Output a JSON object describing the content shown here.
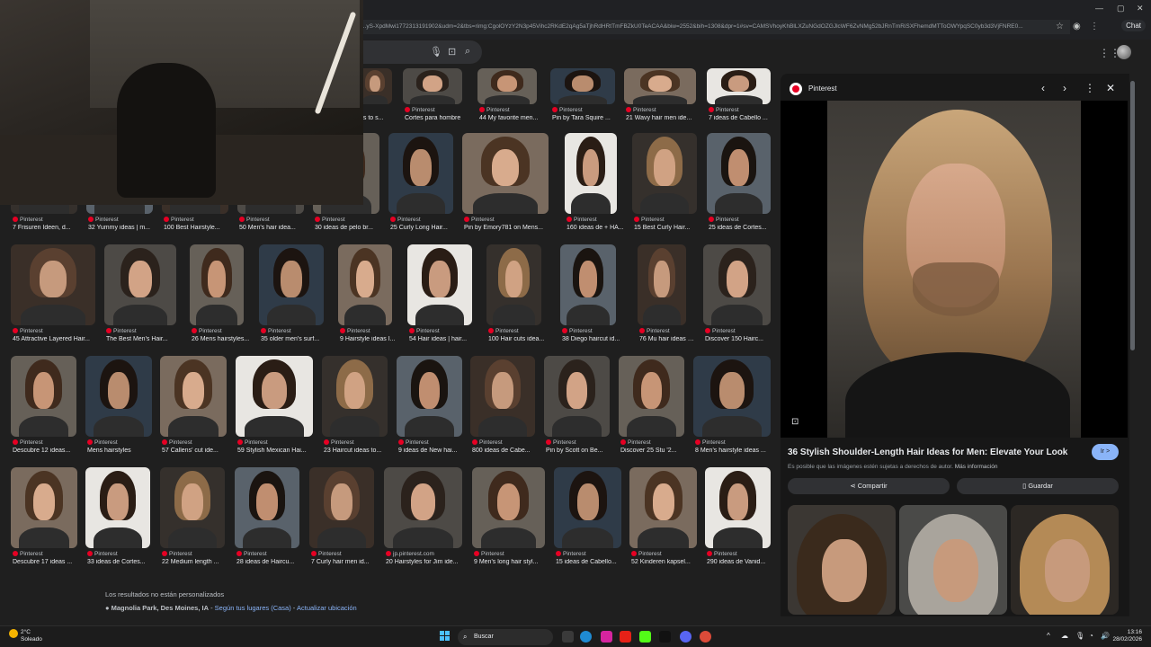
{
  "browser": {
    "url": "...yS-XpdMwi1772313191902&udm=2&tbs=rimg:CgolOYzY2N3p45Vihc2RKdE2qAg5aTjhRdHRtTmFBZkU0TeACAA&biw=2552&bih=1308&dpr=1#sv=CAMSVhoyKhBlLXZuNGdOZGJlcWF6ZvNMg52bJRnTmRiSXFhemdMTToOWYpqSC0yb3d3VjFNRE0...",
    "chat_label": "Chat",
    "window_controls": [
      "—",
      "▢",
      "✕"
    ]
  },
  "google": {
    "mic_icon": "mic-icon",
    "lens_icon": "lens-icon",
    "search_icon": "search-icon",
    "apps_icon": "apps-grid-icon"
  },
  "grid": {
    "rows": [
      {
        "items": [
          {
            "source": "",
            "title": "as to s..."
          },
          {
            "source": "Pinterest",
            "title": "Cortes para hombre"
          },
          {
            "source": "Pinterest",
            "title": "44 My favorite men..."
          },
          {
            "source": "Pinterest",
            "title": "Pin by Tara Squire ..."
          },
          {
            "source": "Pinterest",
            "title": "21 Wavy hair men ide..."
          },
          {
            "source": "Pinterest",
            "title": "7 ideas de Cabello ..."
          }
        ]
      },
      {
        "items": [
          {
            "source": "Pinterest",
            "title": "7 Frisuren Ideen, d..."
          },
          {
            "source": "Pinterest",
            "title": "32 Yummy ideas | m..."
          },
          {
            "source": "Pinterest",
            "title": "100 Best Hairstyle..."
          },
          {
            "source": "Pinterest",
            "title": "50 Men's hair idea..."
          },
          {
            "source": "Pinterest",
            "title": "30 ideas de pelo br..."
          },
          {
            "source": "Pinterest",
            "title": "25 Curly Long Hair..."
          },
          {
            "source": "Pinterest",
            "title": "Pin by Emory781 on Mens..."
          },
          {
            "source": "Pinterest",
            "title": "160 ideas de + HA..."
          },
          {
            "source": "Pinterest",
            "title": "15 Best Curly Hair..."
          },
          {
            "source": "Pinterest",
            "title": "25 ideas de Cortes..."
          }
        ]
      },
      {
        "items": [
          {
            "source": "Pinterest",
            "title": "45 Attractive Layered Hair..."
          },
          {
            "source": "Pinterest",
            "title": "The Best Men's Hair..."
          },
          {
            "source": "Pinterest",
            "title": "26 Mens hairstyles..."
          },
          {
            "source": "Pinterest",
            "title": "35 older men's surf..."
          },
          {
            "source": "Pinterest",
            "title": "9 Hairstyle ideas I..."
          },
          {
            "source": "Pinterest",
            "title": "54 Hair ideas | hair..."
          },
          {
            "source": "Pinterest",
            "title": "100 Hair cuts idea..."
          },
          {
            "source": "Pinterest",
            "title": "38 Diego haircut id..."
          },
          {
            "source": "Pinterest",
            "title": "76 Mu hair ideas | ..."
          },
          {
            "source": "Pinterest",
            "title": "Discover 150 Hairc..."
          }
        ]
      },
      {
        "items": [
          {
            "source": "Pinterest",
            "title": "Descubre 12 ideas..."
          },
          {
            "source": "Pinterest",
            "title": "Mens hairstyles"
          },
          {
            "source": "Pinterest",
            "title": "57 Callens' cut ide..."
          },
          {
            "source": "Pinterest",
            "title": "59 Stylish Mexican Hai..."
          },
          {
            "source": "Pinterest",
            "title": "23 Haircut ideas to..."
          },
          {
            "source": "Pinterest",
            "title": "9 ideas de New hai..."
          },
          {
            "source": "Pinterest",
            "title": "800 ideas de Cabe..."
          },
          {
            "source": "Pinterest",
            "title": "Pin by Scott on Be..."
          },
          {
            "source": "Pinterest",
            "title": "Discover 25 Stu '2..."
          },
          {
            "source": "Pinterest",
            "title": "8 Men's hairstyle ideas ..."
          }
        ]
      },
      {
        "items": [
          {
            "source": "Pinterest",
            "title": "Descubre 17 ideas ..."
          },
          {
            "source": "Pinterest",
            "title": "33 ideas de Cortes..."
          },
          {
            "source": "Pinterest",
            "title": "22 Medium length ..."
          },
          {
            "source": "Pinterest",
            "title": "28 ideas de Haircu..."
          },
          {
            "source": "Pinterest",
            "title": "7 Curly hair men id..."
          },
          {
            "source": "jp.pinterest.com",
            "title": "20 Hairstyles for Jim ide..."
          },
          {
            "source": "Pinterest",
            "title": "9 Men's long hair styl..."
          },
          {
            "source": "Pinterest",
            "title": "15 ideas de Cabello..."
          },
          {
            "source": "Pinterest",
            "title": "52 Kinderen kapsel..."
          },
          {
            "source": "Pinterest",
            "title": "290 ideas de Vanid..."
          }
        ]
      }
    ]
  },
  "footer": {
    "note": "Los resultados no están personalizados",
    "location_bold": "Magnolia Park, Des Moines, IA",
    "location_sep1": " - ",
    "location_link1": "Según tus lugares (Casa)",
    "location_sep2": " - ",
    "location_link2": "Actualizar ubicación"
  },
  "panel": {
    "source": "Pinterest",
    "title": "36 Stylish Shoulder-Length Hair Ideas for Men: Elevate Your Look",
    "visit_label": "Ir >",
    "copyright": "Es posible que las imágenes estén sujetas a derechos de autor.",
    "more_info": "Más información",
    "share_label": "Compartir",
    "save_label": "Guardar"
  },
  "taskbar": {
    "temp": "2°C",
    "condition": "Soleado",
    "search_label": "Buscar",
    "time": "13:16",
    "date": "28/02/2026"
  }
}
